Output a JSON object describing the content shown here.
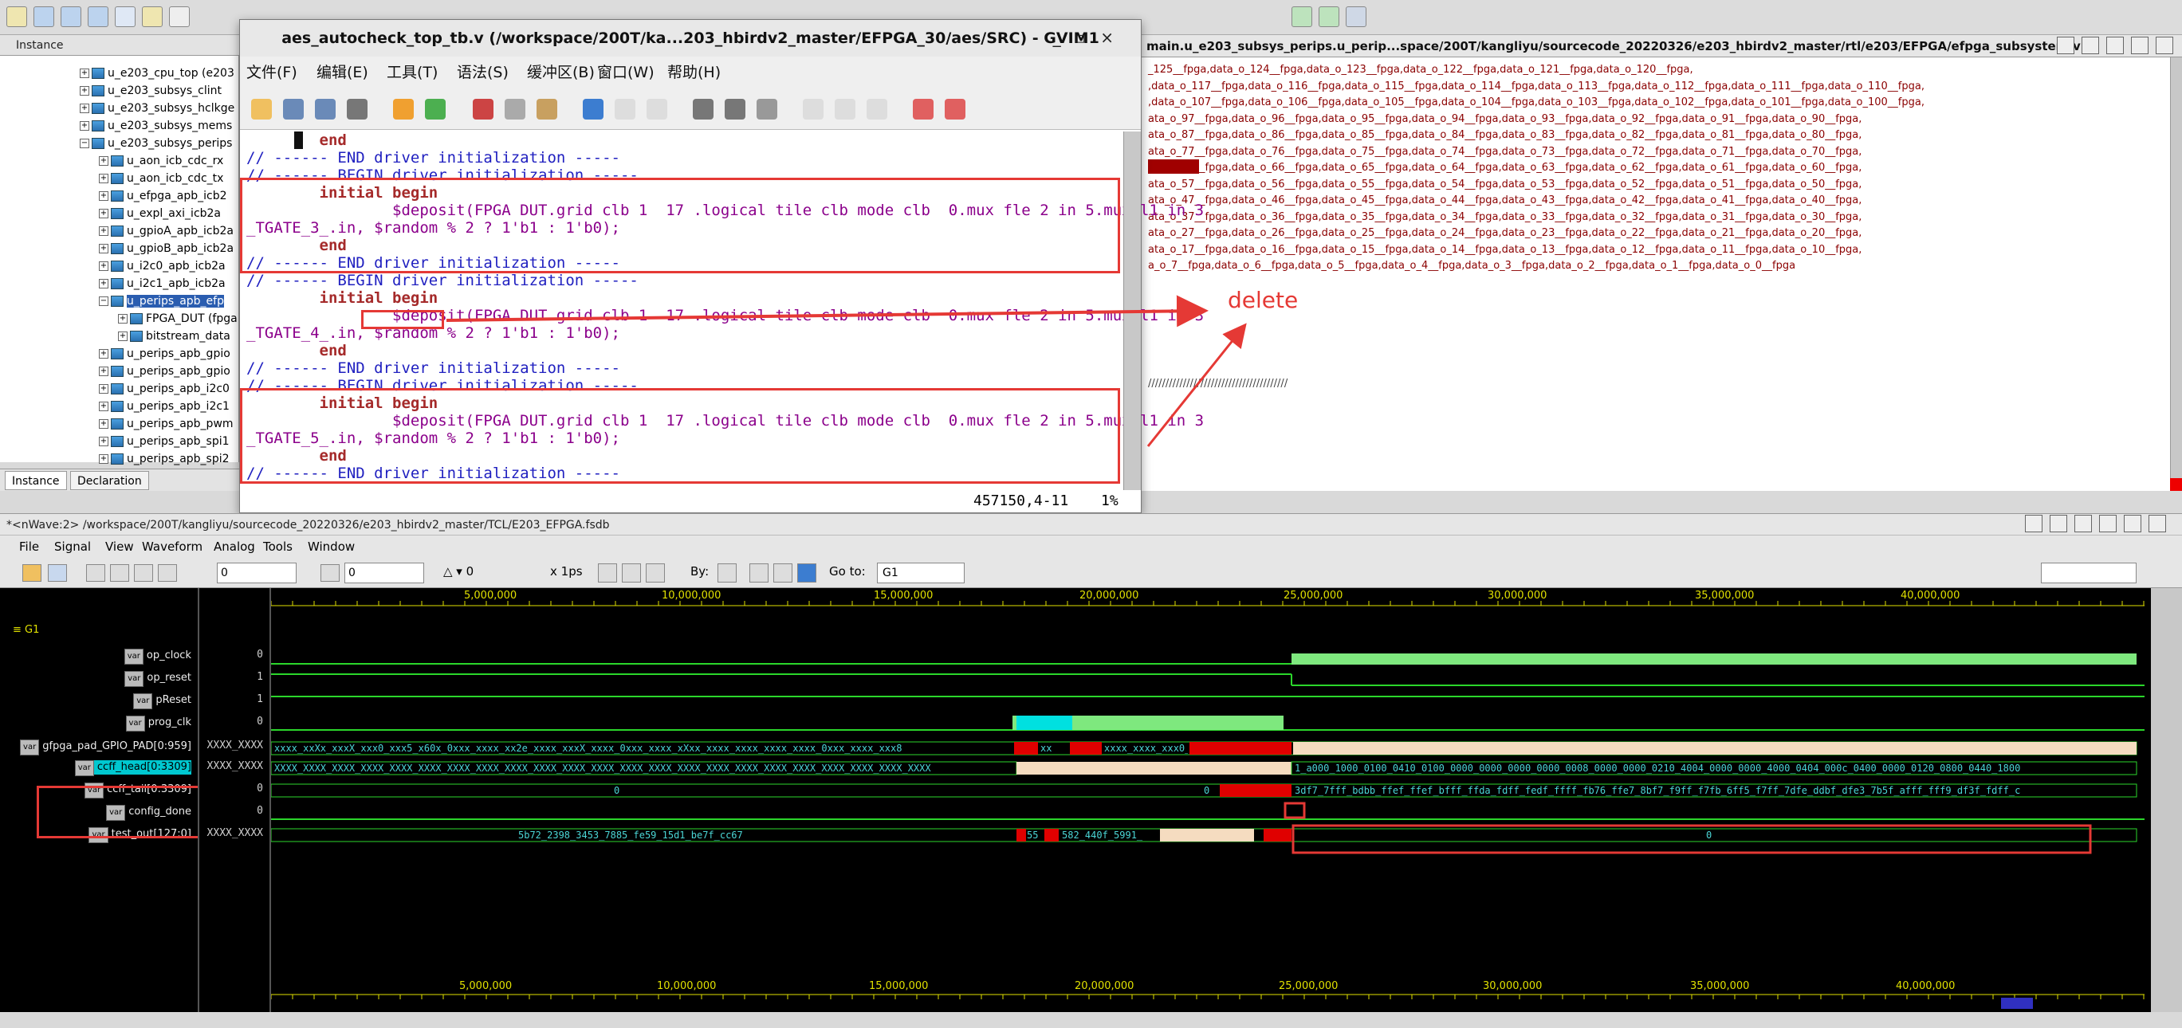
{
  "instance_panel": {
    "header": "Instance",
    "tree": [
      "u_e203_cpu_top (e203",
      "u_e203_subsys_clint",
      "u_e203_subsys_hclkge",
      "u_e203_subsys_mems",
      "u_e203_subsys_perips",
      "u_aon_icb_cdc_rx",
      "u_aon_icb_cdc_tx",
      "u_efpga_apb_icb2",
      "u_expl_axi_icb2a",
      "u_gpioA_apb_icb2a",
      "u_gpioB_apb_icb2a",
      "u_i2c0_apb_icb2a",
      "u_i2c1_apb_icb2a",
      "u_perips_apb_efp",
      "FPGA_DUT (fpga",
      "bitstream_data",
      "u_perips_apb_gpio",
      "u_perips_apb_gpio",
      "u_perips_apb_i2c0",
      "u_perips_apb_i2c1",
      "u_perips_apb_pwm",
      "u_perips_apb_spi1",
      "u_perips_apb_spi2"
    ],
    "tabs": [
      "Instance",
      "Declaration"
    ]
  },
  "source_panel": {
    "title": "main.u_e203_subsys_perips.u_perip...space/200T/kangliyu/sourcecode_20220326/e203_hbirdv2_master/rtl/e203/EFPGA/efpga_subsystem.v",
    "lines": [
      "_125__fpga,data_o_124__fpga,data_o_123__fpga,data_o_122__fpga,data_o_121__fpga,data_o_120__fpga,",
      ",data_o_117__fpga,data_o_116__fpga,data_o_115__fpga,data_o_114__fpga,data_o_113__fpga,data_o_112__fpga,data_o_111__fpga,data_o_110__fpga,",
      ",data_o_107__fpga,data_o_106__fpga,data_o_105__fpga,data_o_104__fpga,data_o_103__fpga,data_o_102__fpga,data_o_101__fpga,data_o_100__fpga,",
      "ata_o_97__fpga,data_o_96__fpga,data_o_95__fpga,data_o_94__fpga,data_o_93__fpga,data_o_92__fpga,data_o_91__fpga,data_o_90__fpga,",
      "ata_o_87__fpga,data_o_86__fpga,data_o_85__fpga,data_o_84__fpga,data_o_83__fpga,data_o_82__fpga,data_o_81__fpga,data_o_80__fpga,",
      "ata_o_77__fpga,data_o_76__fpga,data_o_75__fpga,data_o_74__fpga,data_o_73__fpga,data_o_72__fpga,data_o_71__fpga,data_o_70__fpga,",
      "ata_o_67__fpga,data_o_66__fpga,data_o_65__fpga,data_o_64__fpga,data_o_63__fpga,data_o_62__fpga,data_o_61__fpga,data_o_60__fpga,",
      "ata_o_57__fpga,data_o_56__fpga,data_o_55__fpga,data_o_54__fpga,data_o_53__fpga,data_o_52__fpga,data_o_51__fpga,data_o_50__fpga,",
      "ata_o_47__fpga,data_o_46__fpga,data_o_45__fpga,data_o_44__fpga,data_o_43__fpga,data_o_42__fpga,data_o_41__fpga,data_o_40__fpga,",
      "ata_o_37__fpga,data_o_36__fpga,data_o_35__fpga,data_o_34__fpga,data_o_33__fpga,data_o_32__fpga,data_o_31__fpga,data_o_30__fpga,",
      "ata_o_27__fpga,data_o_26__fpga,data_o_25__fpga,data_o_24__fpga,data_o_23__fpga,data_o_22__fpga,data_o_21__fpga,data_o_20__fpga,",
      "ata_o_17__fpga,data_o_16__fpga,data_o_15__fpga,data_o_14__fpga,data_o_13__fpga,data_o_12__fpga,data_o_11__fpga,data_o_10__fpga,",
      "a_o_7__fpga,data_o_6__fpga,data_o_5__fpga,data_o_4__fpga,data_o_3__fpga,data_o_2__fpga,data_o_1__fpga,data_o_0__fpga"
    ],
    "separator": "////////////////////////////////////////"
  },
  "gvim": {
    "title": "aes_autocheck_top_tb.v (/workspace/200T/ka...203_hbirdv2_master/EFPGA_30/aes/SRC) - GVIM1",
    "menu": [
      "文件(F)",
      "编辑(E)",
      "工具(T)",
      "语法(S)",
      "缓冲区(B)",
      "窗口(W)",
      "帮助(H)"
    ],
    "code": [
      {
        "t": "        end",
        "c": "kw"
      },
      {
        "t": "// ------ END driver initialization -----",
        "c": "cm"
      },
      {
        "t": "// ------ BEGIN driver initialization -----",
        "c": "cm"
      },
      {
        "t": "        initial begin",
        "c": "kw"
      },
      {
        "t": "                $deposit(FPGA DUT.grid clb 1  17 .logical tile clb mode clb  0.mux fle 2 in 5.mux l1 in 3",
        "c": "fn"
      },
      {
        "t": "_TGATE_3_.in, $random % 2 ? 1'b1 : 1'b0);",
        "c": "fn"
      },
      {
        "t": "        end",
        "c": "kw"
      },
      {
        "t": "// ------ END driver initialization -----",
        "c": "cm"
      },
      {
        "t": "// ------ BEGIN driver initialization -----",
        "c": "cm"
      },
      {
        "t": "        initial begin",
        "c": "kw"
      },
      {
        "t": "                $deposit(FPGA DUT.grid clb 1  17 .logical tile clb mode clb  0.mux fle 2 in 5.mux l1 in 3",
        "c": "fn"
      },
      {
        "t": "_TGATE_4_.in, $random % 2 ? 1'b1 : 1'b0);",
        "c": "fn"
      },
      {
        "t": "        end",
        "c": "kw"
      },
      {
        "t": "// ------ END driver initialization -----",
        "c": "cm"
      },
      {
        "t": "// ------ BEGIN driver initialization -----",
        "c": "cm"
      },
      {
        "t": "        initial begin",
        "c": "kw"
      },
      {
        "t": "                $deposit(FPGA DUT.grid clb 1  17 .logical tile clb mode clb  0.mux fle 2 in 5.mux l1 in 3",
        "c": "fn"
      },
      {
        "t": "_TGATE_5_.in, $random % 2 ? 1'b1 : 1'b0);",
        "c": "fn"
      },
      {
        "t": "        end",
        "c": "kw"
      },
      {
        "t": "// ------ END driver initialization -----",
        "c": "cm"
      }
    ],
    "status_pos": "457150,4-11",
    "status_pct": "1%"
  },
  "annotation": {
    "label": "delete"
  },
  "nwave": {
    "title": "*<nWave:2> /workspace/200T/kangliyu/sourcecode_20220326/e203_hbirdv2_master/TCL/E203_EFPGA.fsdb",
    "menu": [
      "File",
      "Signal",
      "View",
      "Waveform",
      "Analog",
      "Tools",
      "Window"
    ],
    "toolbar": {
      "cursor_value": "0",
      "marker_value": "0",
      "delta": "0",
      "time_unit": "x 1ps",
      "by_label": "By:",
      "goto_label": "Go to:",
      "goto_value": "G1"
    },
    "group": "G1",
    "signals": [
      {
        "name": "op_clock",
        "value": "0"
      },
      {
        "name": "op_reset",
        "value": "1"
      },
      {
        "name": "pReset",
        "value": "1"
      },
      {
        "name": "prog_clk",
        "value": "0"
      },
      {
        "name": "gfpga_pad_GPIO_PAD[0:959]",
        "value": "XXXX_XXXX"
      },
      {
        "name": "ccff_head[0:3309]",
        "value": "XXXX_XXXX"
      },
      {
        "name": "ccff_tail[0:3309]",
        "value": "0"
      },
      {
        "name": "config_done",
        "value": "0"
      },
      {
        "name": "test_out[127:0]",
        "value": "XXXX_XXXX"
      }
    ],
    "timeline_top": [
      "5,000,000",
      "10,000,000",
      "15,000,000",
      "20,000,000",
      "25,000,000",
      "30,000,000",
      "35,000,000",
      "40,000,000"
    ],
    "timeline_bottom": [
      "5,000,000",
      "10,000,000",
      "15,000,000",
      "20,000,000",
      "25,000,000",
      "30,000,000",
      "35,000,000",
      "40,000,000"
    ],
    "wave_text": {
      "gpio_left": "xxxx_xxXx_xxxX_xxx0_xxx5_x60x_0xxx_xxxx_xx2e_xxxx_xxxX_xxxx_0xxx_xxxx_xXxx_xxxx_xxxx_xxxx_xxxx_0xxx_xxxx_xxx8",
      "gpio_mid": "xxxx_xxxx_xxx0_x",
      "gpio_small": "xx",
      "ccff_head_left": "XXXX_XXXX_XXXX_XXXX_XXXX_XXXX_XXXX_XXXX_XXXX_XXXX_XXXX_XXXX_XXXX_XXXX_XXXX_XXXX_XXXX_XXXX_XXXX_XXXX_XXXX_XXXX_XXXX",
      "ccff_head_right": "1_a000_1000_0100_0410_0100_0000_0000_0000_0000_0008_0000_0000_0210_4004_0000_0000_4000_0404_000c_0400_0000_0120_0800_0440_1800",
      "ccff_tail_left": "0",
      "ccff_tail_right": "3df7_7fff_bdbb_ffef_ffef_bfff_ffda_fdff_fedf_ffff_fb76_ffe7_8bf7_f9ff_f7fb_6ff5_f7ff_7dfe_ddbf_dfe3_7b5f_afff_fff9_df3f_fdff_c",
      "ccff_tail_mid": "0",
      "test_out_left": "5b72_2398_3453_7885_fe59_15d1_be7f_cc67",
      "test_out_mid1": "55",
      "test_out_mid2": "582_440f_5991_",
      "test_out_right": "0"
    }
  }
}
